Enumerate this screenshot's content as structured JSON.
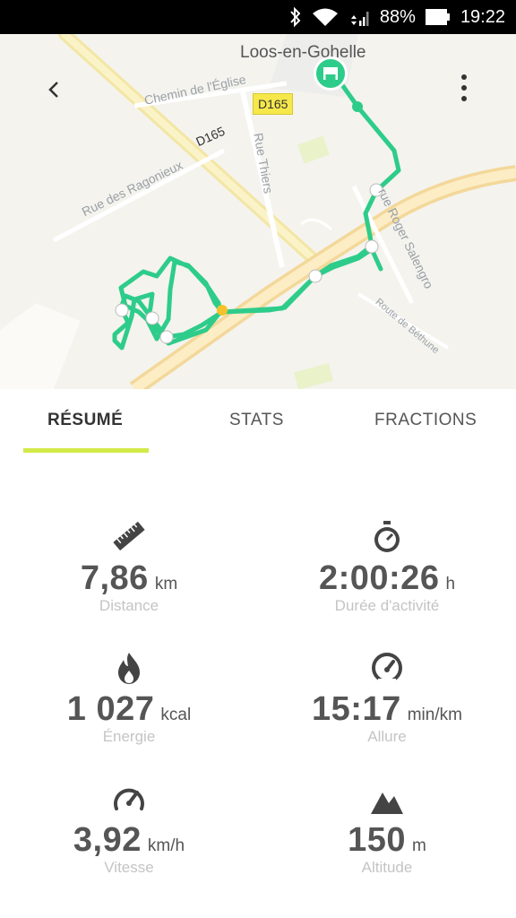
{
  "status_bar": {
    "battery": "88%",
    "time": "19:22",
    "icons": [
      "bluetooth-icon",
      "wifi-icon",
      "cell-signal-icon",
      "battery-icon"
    ]
  },
  "map": {
    "town": "Loos-en-Gohelle",
    "road_badge": "D165",
    "labels": {
      "chemin": "Chemin de l'Église",
      "d165": "D165",
      "thiers": "Rue Thiers",
      "ragonieux": "Rue des Ragonieux",
      "salengro": "rue Roger Salengro",
      "bethune": "Route de Béthune"
    }
  },
  "tabs": {
    "resume": "RÉSUMÉ",
    "stats": "STATS",
    "fractions": "FRACTIONS",
    "active": "resume"
  },
  "stats": {
    "distance": {
      "value": "7,86",
      "unit": "km",
      "label": "Distance",
      "icon": "ruler-icon"
    },
    "duration": {
      "value": "2:00:26",
      "unit": "h",
      "label": "Durée d'activité",
      "icon": "stopwatch-icon"
    },
    "energy": {
      "value": "1 027",
      "unit": "kcal",
      "label": "Énergie",
      "icon": "flame-icon"
    },
    "pace": {
      "value": "15:17",
      "unit": "min/km",
      "label": "Allure",
      "icon": "speedometer-icon"
    },
    "speed": {
      "value": "3,92",
      "unit": "km/h",
      "label": "Vitesse",
      "icon": "gauge-icon"
    },
    "altitude": {
      "value": "150",
      "unit": "m",
      "label": "Altitude",
      "icon": "mountain-icon"
    }
  },
  "colors": {
    "route": "#2ecc8a",
    "tab_underline": "#d2ea47",
    "major_road": "#f7d98a",
    "current_point": "#f5c22a"
  }
}
